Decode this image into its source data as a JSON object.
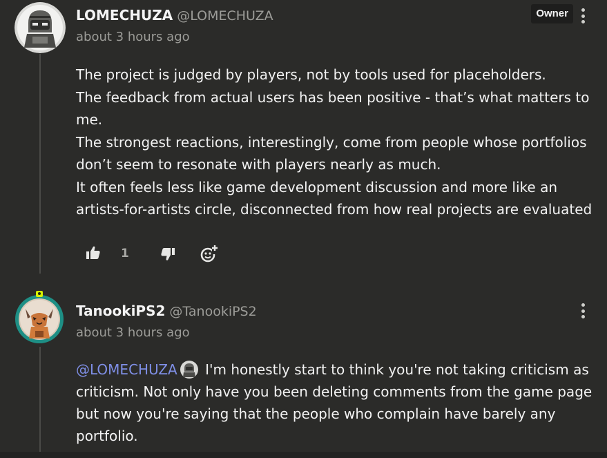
{
  "comments": [
    {
      "author": "LOMECHUZA",
      "handle": "@LOMECHUZA",
      "time": "about 3 hours ago",
      "badge": "Owner",
      "paragraphs": [
        "The project is judged by players, not by tools used for placeholders.",
        "The feedback from actual users has been positive - that’s what matters to me.",
        "The strongest reactions, interestingly, come from people whose portfolios don’t seem to resonate with players nearly as much.",
        "It often feels less like game development discussion and more like an artists-for-artists circle, disconnected from how real projects are evaluated"
      ],
      "like_count": "1",
      "icons": {
        "avatar": "robot-avatar",
        "like": "thumbs-up-icon",
        "dislike": "thumbs-down-icon",
        "react": "add-reaction-icon",
        "menu": "more-vertical-icon"
      }
    },
    {
      "author": "TanookiPS2",
      "handle": "@TanookiPS2",
      "time": "about 3 hours ago",
      "mention": "@LOMECHUZA",
      "text": "I'm honestly start to think you're not taking criticism as criticism. Not only have you been deleting comments from the game page but now you're saying that the people who complain have barely any portfolio.",
      "icons": {
        "avatar": "fox-avatar",
        "mention_avatar": "robot-avatar",
        "menu": "more-vertical-icon"
      }
    }
  ],
  "colors": {
    "background": "#2b2b29",
    "mention": "#7f8fe6",
    "muted": "#9c9c98",
    "badge": "#1e1e1d"
  }
}
